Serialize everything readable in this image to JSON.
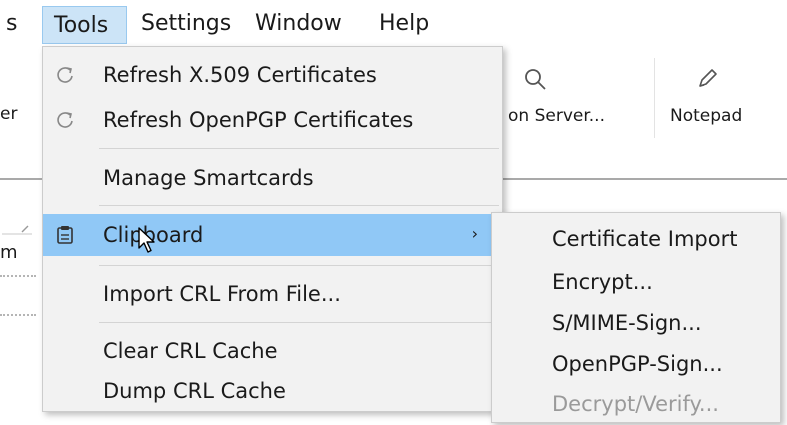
{
  "menubar": {
    "items": [
      {
        "label": "s"
      },
      {
        "label": "Tools"
      },
      {
        "label": "Settings"
      },
      {
        "label": "Window"
      },
      {
        "label": "Help"
      }
    ]
  },
  "toolbar": {
    "left_fragment": "er",
    "lookup_server_label": "on Server...",
    "notepad_label": "Notepad"
  },
  "background": {
    "left_fragment_m": "m"
  },
  "tools_menu": {
    "items": [
      {
        "label": "Refresh X.509 Certificates",
        "icon": "refresh-icon"
      },
      {
        "label": "Refresh OpenPGP Certificates",
        "icon": "refresh-icon"
      },
      {
        "label": "Manage Smartcards"
      },
      {
        "label": "Clipboard",
        "icon": "clipboard-icon",
        "has_submenu": true,
        "highlighted": true
      },
      {
        "label": "Import CRL From File..."
      },
      {
        "label": "Clear CRL Cache"
      },
      {
        "label": "Dump CRL Cache"
      }
    ],
    "submenu_arrow": "›"
  },
  "clipboard_submenu": {
    "items": [
      {
        "label": "Certificate Import",
        "enabled": true
      },
      {
        "label": "Encrypt...",
        "enabled": true
      },
      {
        "label": "S/MIME-Sign...",
        "enabled": true
      },
      {
        "label": "OpenPGP-Sign...",
        "enabled": true
      },
      {
        "label": "Decrypt/Verify...",
        "enabled": false
      }
    ]
  },
  "colors": {
    "menu_background": "#f2f2f2",
    "highlight": "#90c8f6",
    "active_menu": "#cce4f7",
    "disabled_text": "#9a9a9a"
  }
}
